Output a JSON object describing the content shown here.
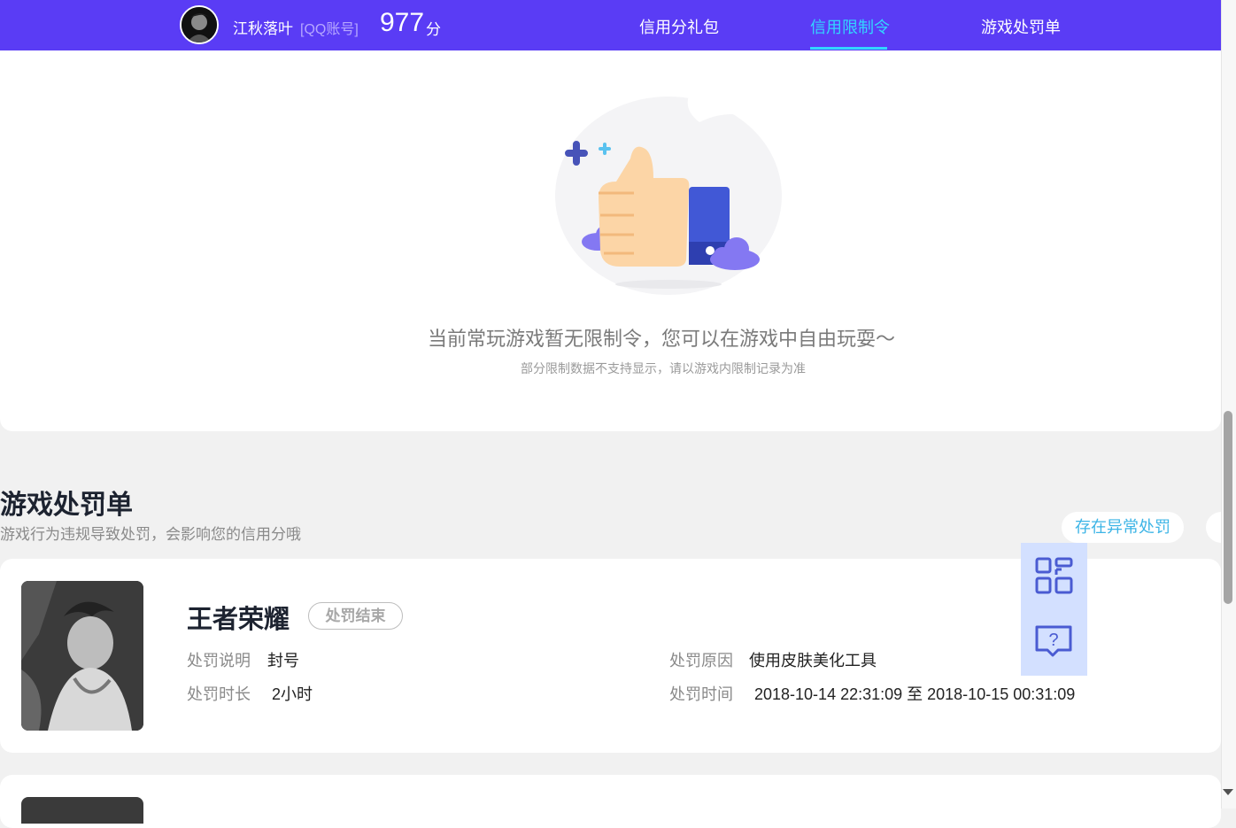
{
  "header": {
    "username": "江秋落叶",
    "account_type": "[QQ账号]",
    "score": "977",
    "score_unit": "分",
    "nav": [
      {
        "label": "信用分礼包",
        "active": false
      },
      {
        "label": "信用限制令",
        "active": true
      },
      {
        "label": "游戏处罚单",
        "active": false
      }
    ]
  },
  "restriction": {
    "empty_message": "当前常玩游戏暂无限制令，您可以在游戏中自由玩耍～",
    "empty_note": "部分限制数据不支持显示，请以游戏内限制记录为准",
    "illustration_icon": "thumbs-up-icon"
  },
  "penalties": {
    "title": "游戏处罚单",
    "subtitle": "游戏行为违规导致处罚，会影响您的信用分哦",
    "filter_label": "存在异常处罚",
    "items": [
      {
        "game": "王者荣耀",
        "status": "处罚结束",
        "desc_label": "处罚说明",
        "desc_value": "封号",
        "duration_label": "处罚时长",
        "duration_value": "2小时",
        "reason_label": "处罚原因",
        "reason_value": "使用皮肤美化工具",
        "time_label": "处罚时间",
        "time_value": "2018-10-14 22:31:09 至 2018-10-15 00:31:09"
      }
    ]
  },
  "floating": {
    "qr_icon": "qr-code-icon",
    "help_icon": "help-chat-icon"
  },
  "colors": {
    "header_bg": "#5a3cf5",
    "active_nav": "#32d6ff",
    "accent": "#3cb4e6"
  }
}
